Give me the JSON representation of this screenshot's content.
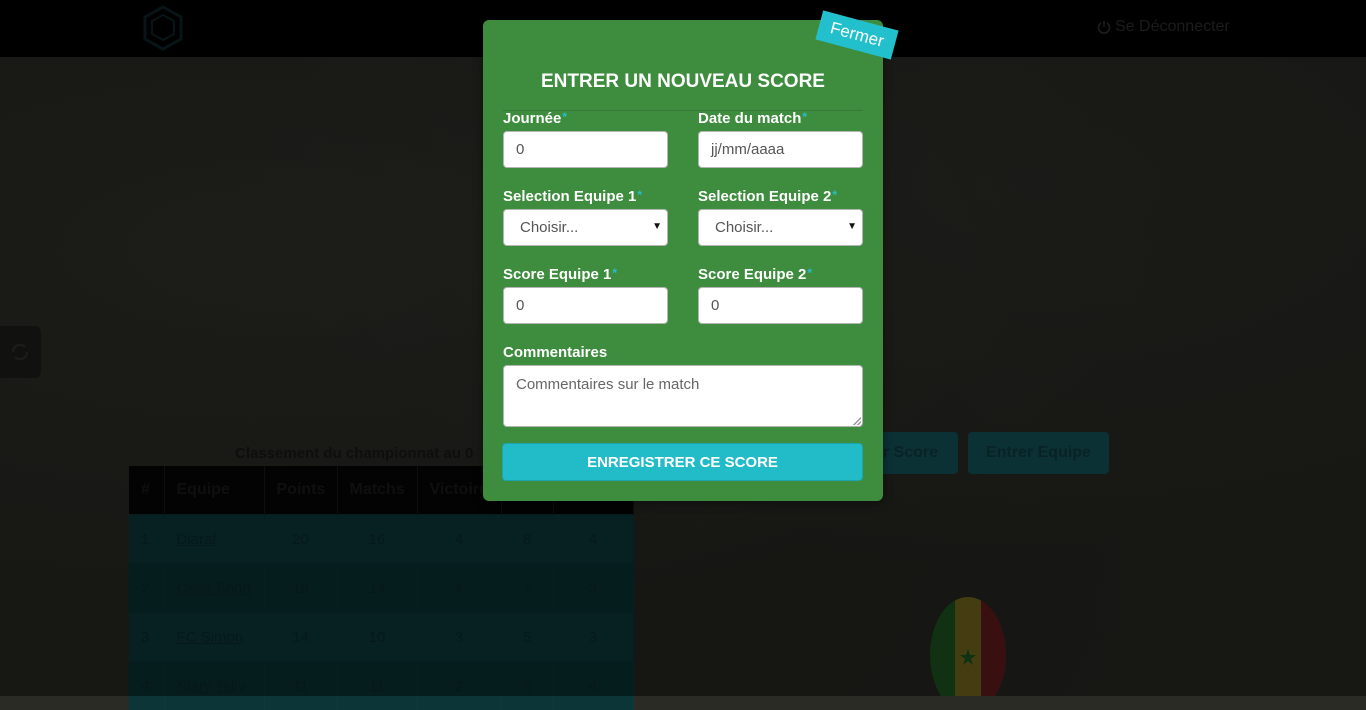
{
  "header": {
    "logout_label": "Se Déconnecter"
  },
  "ranking": {
    "title": "Classement du championnat au 0",
    "columns": [
      "#",
      "Equipe",
      "Points",
      "Matchs",
      "Victoires"
    ],
    "rows": [
      {
        "rank": "1",
        "team": "Diaraf",
        "points": "20",
        "matches": "16",
        "wins": "4",
        "col6": "8",
        "col7": "4"
      },
      {
        "rank": "2",
        "team": "Casa Sport",
        "points": "19",
        "matches": "14",
        "wins": "4",
        "col6": "7",
        "col7": "3"
      },
      {
        "rank": "3",
        "team": "FC Simon",
        "points": "14",
        "matches": "10",
        "wins": "3",
        "col6": "5",
        "col7": "3"
      },
      {
        "rank": "4",
        "team": "Niary Tally",
        "points": "11",
        "matches": "11",
        "wins": "2",
        "col6": "5",
        "col7": "4"
      }
    ]
  },
  "background_buttons": {
    "enter_score_partial": "r Score",
    "enter_team": "Entrer Equipe"
  },
  "modal": {
    "title": "ENTRER UN NOUVEAU SCORE",
    "close_label": "Fermer",
    "required_marker": "*",
    "day_label": "Journée",
    "day_placeholder": "0",
    "date_label": "Date du match",
    "date_placeholder": "jj/mm/aaaa",
    "team1_select_label": "Selection Equipe 1",
    "team1_select_value": "Choisir...",
    "team2_select_label": "Selection Equipe 2",
    "team2_select_value": "Choisir...",
    "score1_label": "Score Equipe 1",
    "score1_placeholder": "0",
    "score2_label": "Score Equipe 2",
    "score2_placeholder": "0",
    "comments_label": "Commentaires",
    "comments_placeholder": "Commentaires sur le match",
    "submit_label": "ENREGISTRER CE SCORE"
  },
  "colors": {
    "modal_bg": "#3e8c3e",
    "accent": "#22c0cc"
  }
}
